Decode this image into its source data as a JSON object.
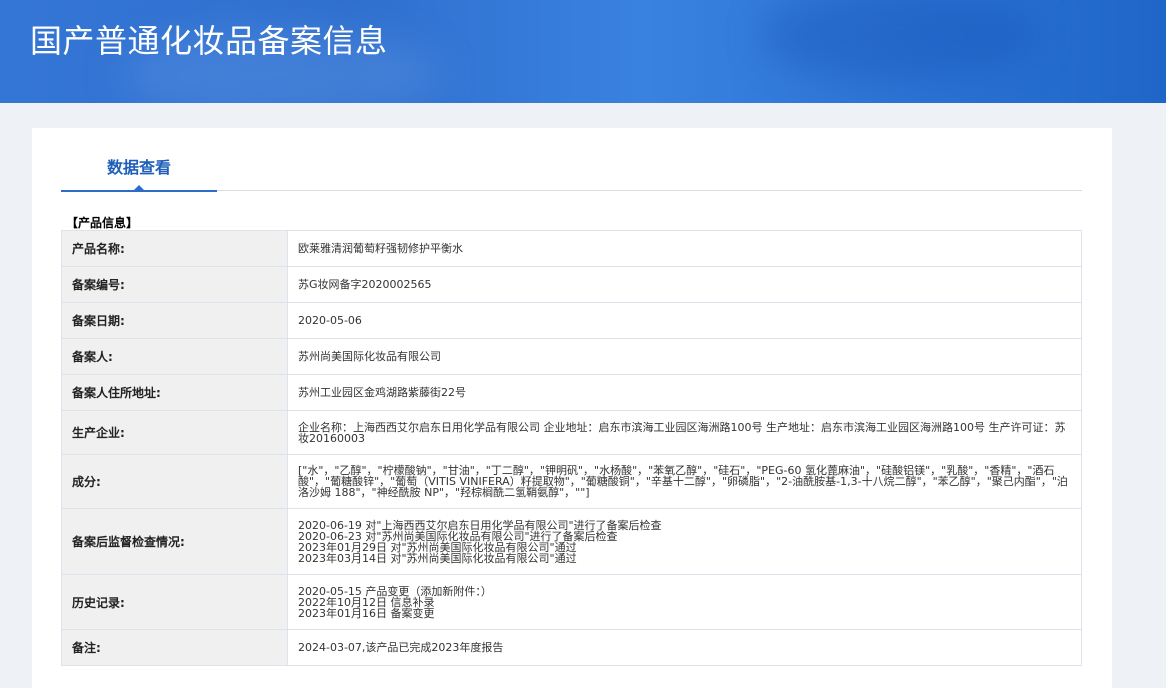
{
  "header": {
    "title": "国产普通化妆品备案信息"
  },
  "tabs": [
    {
      "label": "数据查看"
    }
  ],
  "section": {
    "label": "【产品信息】"
  },
  "fields": {
    "product_name": {
      "label": "产品名称:",
      "value": "欧莱雅清润葡萄籽强韧修护平衡水"
    },
    "record_no": {
      "label": "备案编号:",
      "value": "苏G妆网备字2020002565"
    },
    "record_date": {
      "label": "备案日期:",
      "value": "2020-05-06"
    },
    "registrant": {
      "label": "备案人:",
      "value": "苏州尚美国际化妆品有限公司"
    },
    "registrant_address": {
      "label": "备案人住所地址:",
      "value": "苏州工业园区金鸡湖路紫藤街22号"
    },
    "manufacturer": {
      "label": "生产企业:",
      "value": "企业名称：上海西西艾尔启东日用化学品有限公司 企业地址：启东市滨海工业园区海洲路100号 生产地址：启东市滨海工业园区海洲路100号 生产许可证：苏妆20160003"
    },
    "ingredients": {
      "label": "成分:",
      "value": "[\"水\"，\"乙醇\"，\"柠檬酸钠\"，\"甘油\"，\"丁二醇\"，\"钾明矾\"，\"水杨酸\"，\"苯氧乙醇\"，\"硅石\"，\"PEG-60 氢化蓖麻油\"，\"硅酸铝镁\"，\"乳酸\"，\"香精\"，\"酒石酸\"，\"葡糖酸锌\"，\"葡萄（VITIS VINIFERA）籽提取物\"，\"葡糖酸铜\"，\"辛基十二醇\"，\"卵磷脂\"，\"2-油酰胺基-1,3-十八烷二醇\"，\"苯乙醇\"，\"聚己内酯\"，\"泊洛沙姆 188\"，\"神经酰胺 NP\"，\"羟棕榈酰二氢鞘氨醇\"，\"\"]"
    },
    "inspection": {
      "label": "备案后监督检查情况:",
      "lines": [
        "2020-06-19 对\"上海西西艾尔启东日用化学品有限公司\"进行了备案后检查",
        "2020-06-23 对\"苏州尚美国际化妆品有限公司\"进行了备案后检查",
        "2023年01月29日 对\"苏州尚美国际化妆品有限公司\"通过",
        "2023年03月14日 对\"苏州尚美国际化妆品有限公司\"通过"
      ]
    },
    "history": {
      "label": "历史记录:",
      "lines": [
        "2020-05-15 产品变更（添加新附件：）",
        "2022年10月12日 信息补录",
        "2023年01月16日 备案变更"
      ]
    },
    "remarks": {
      "label": "备注:",
      "value": "2024-03-07,该产品已完成2023年度报告"
    }
  }
}
